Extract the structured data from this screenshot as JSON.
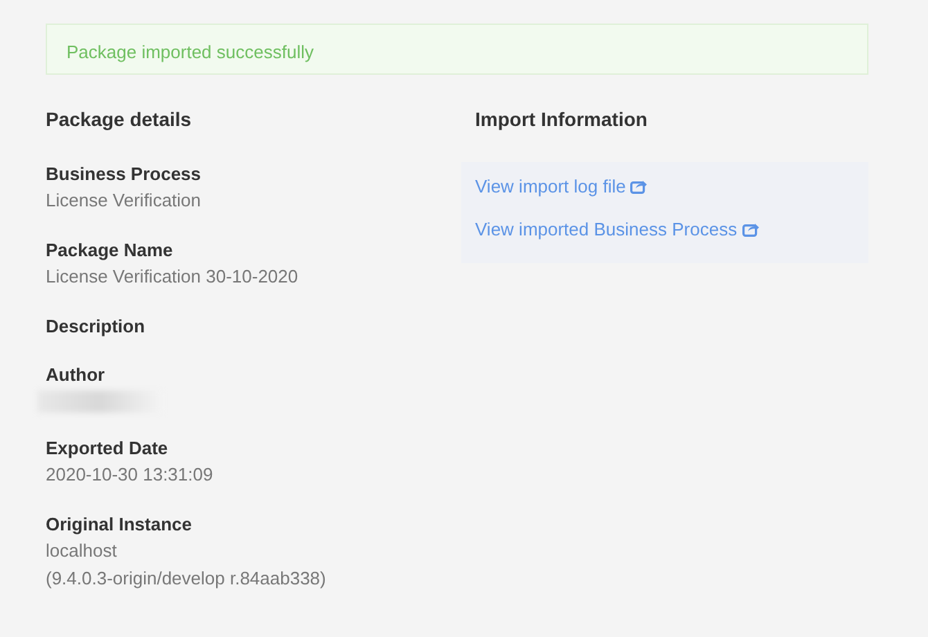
{
  "alert": {
    "text": "Package imported successfully"
  },
  "package_details": {
    "title": "Package details",
    "fields": [
      {
        "label": "Business Process",
        "values": [
          "License Verification"
        ]
      },
      {
        "label": "Package Name",
        "values": [
          "License Verification 30-10-2020"
        ]
      },
      {
        "label": "Description"
      },
      {
        "label": "Author",
        "redacted": true
      },
      {
        "label": "Exported Date",
        "values": [
          "2020-10-30 13:31:09"
        ]
      },
      {
        "label": "Original Instance",
        "values": [
          "localhost",
          "(9.4.0.3-origin/develop r.84aab338)"
        ]
      }
    ]
  },
  "import_information": {
    "title": "Import Information",
    "links": [
      {
        "text": "View import log file"
      },
      {
        "text": "View imported Business Process"
      }
    ]
  }
}
